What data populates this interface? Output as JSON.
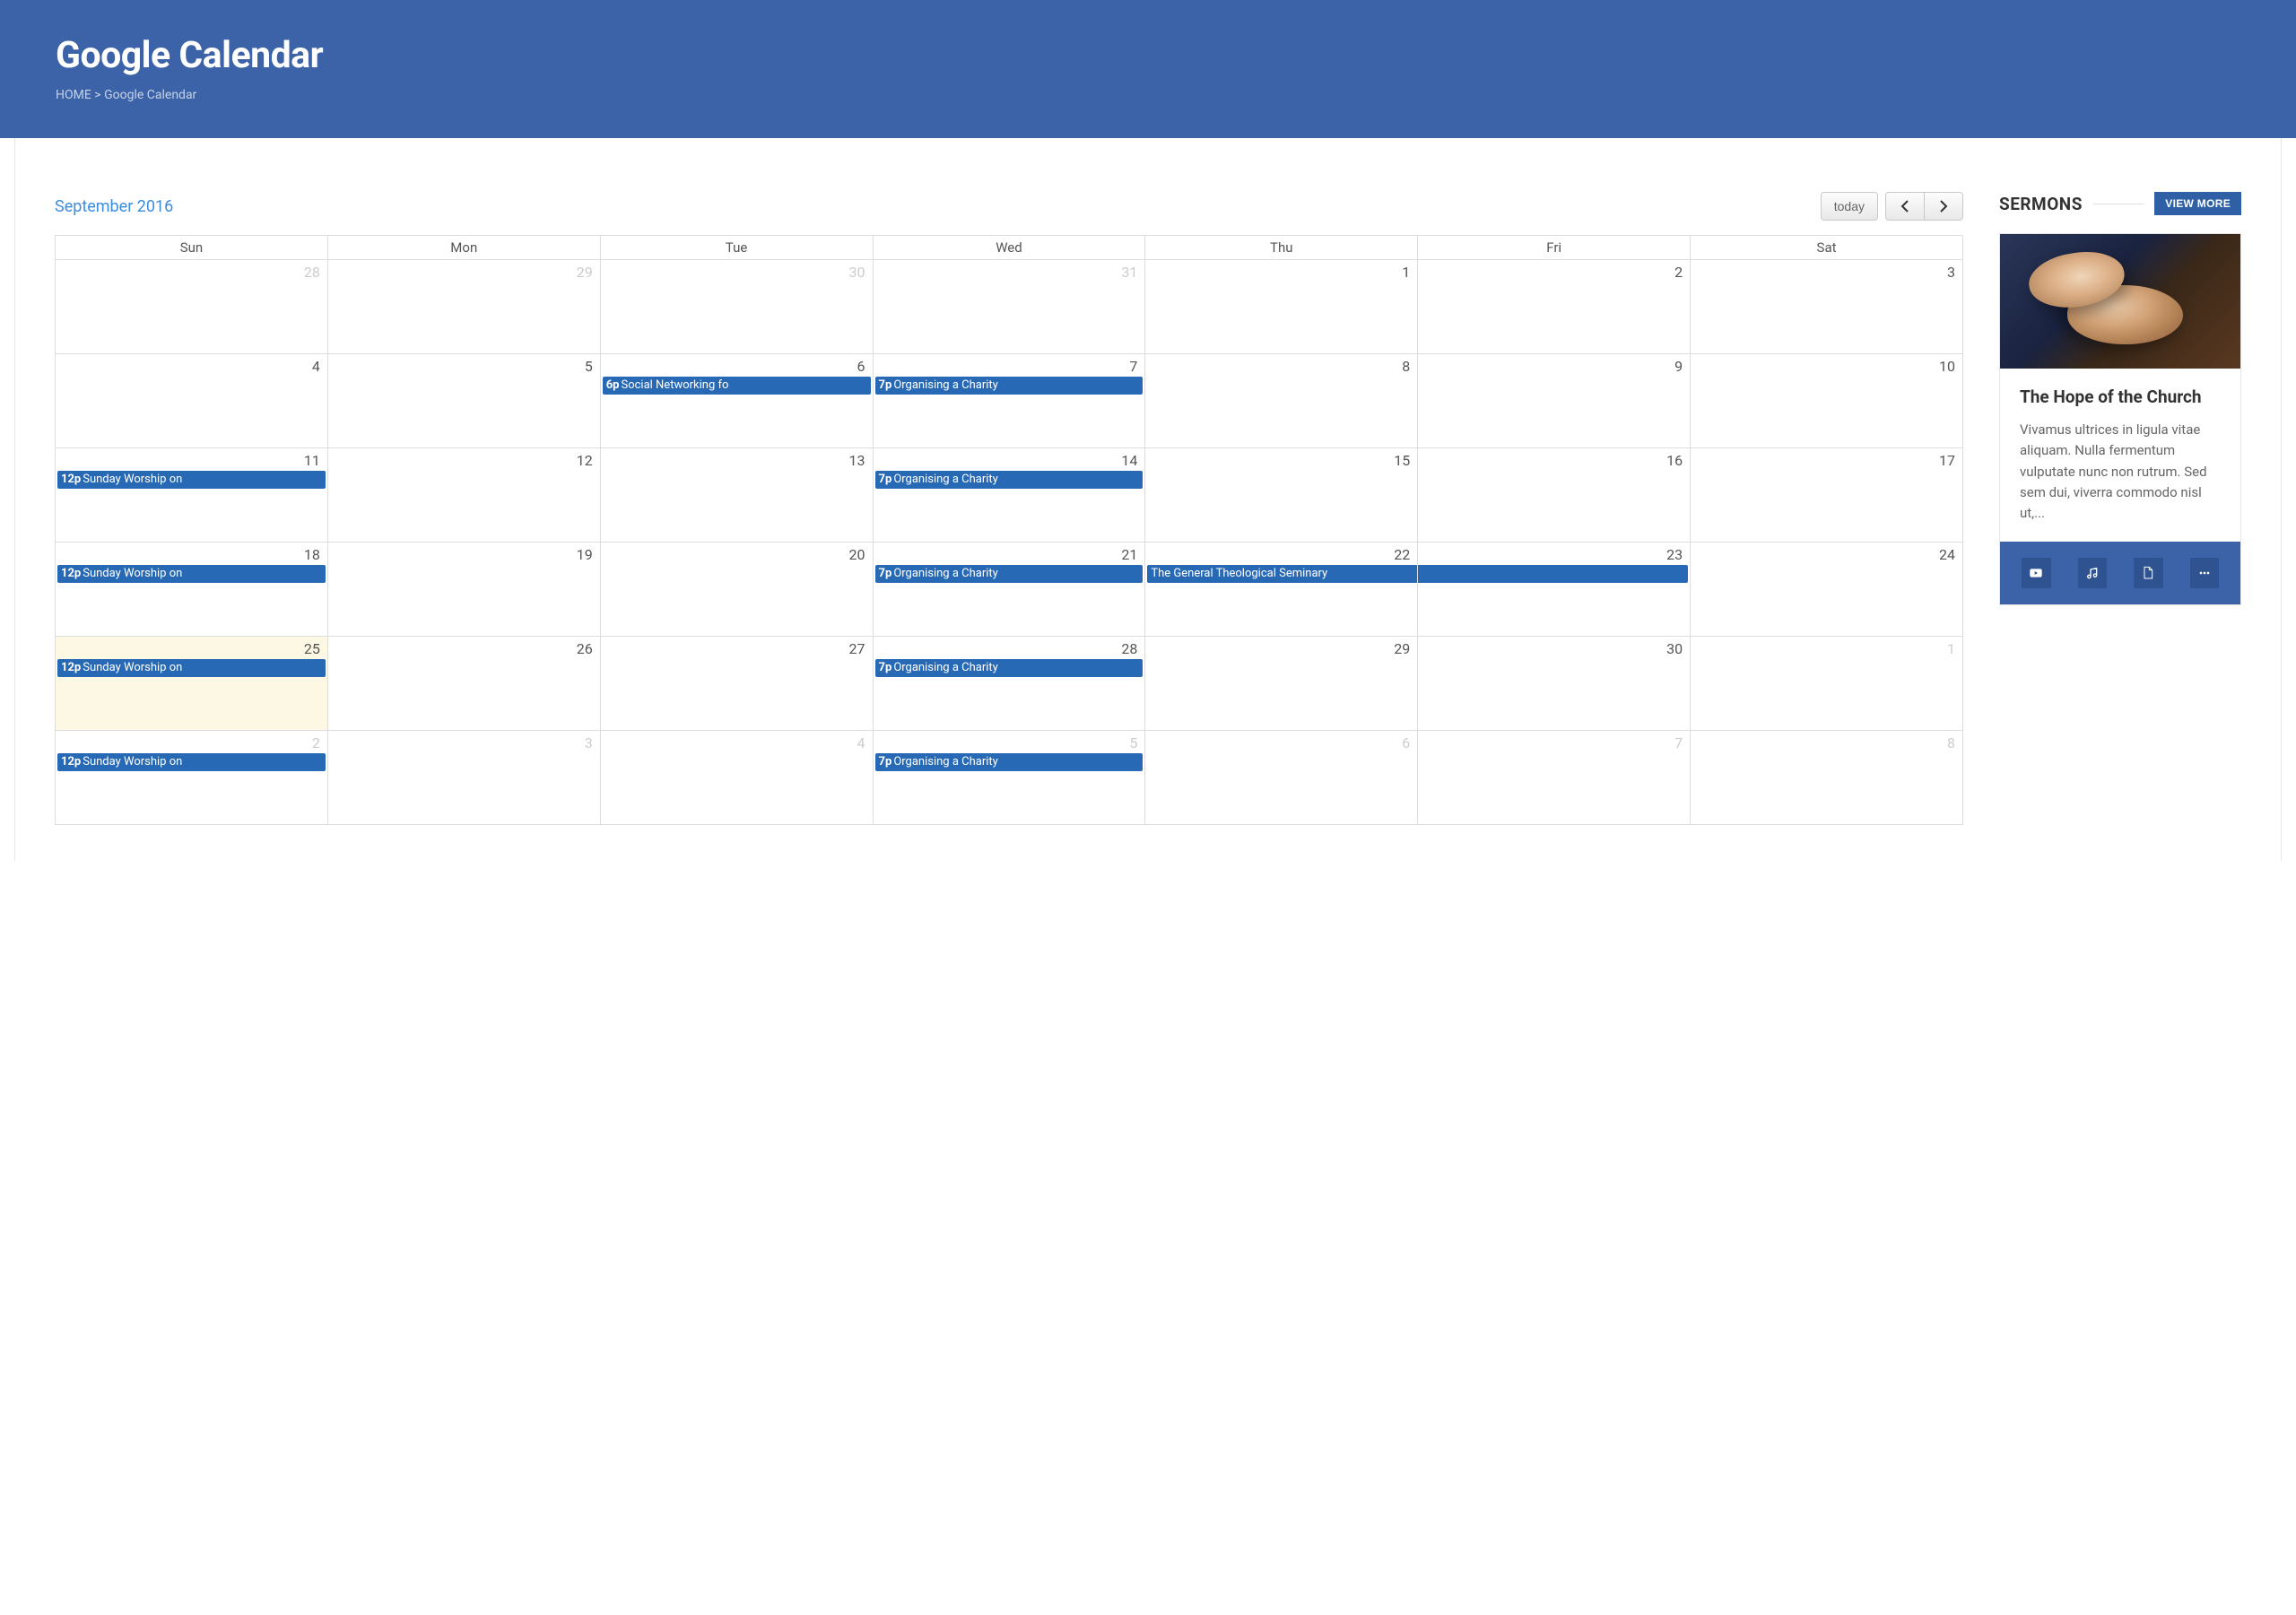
{
  "header": {
    "title": "Google Calendar",
    "breadcrumb_home": "HOME",
    "breadcrumb_sep": " > ",
    "breadcrumb_current": "Google Calendar"
  },
  "calendar": {
    "month_label": "September 2016",
    "today_label": "today",
    "day_headers": [
      "Sun",
      "Mon",
      "Tue",
      "Wed",
      "Thu",
      "Fri",
      "Sat"
    ],
    "weeks": [
      [
        {
          "num": "28",
          "other": true,
          "events": []
        },
        {
          "num": "29",
          "other": true,
          "events": []
        },
        {
          "num": "30",
          "other": true,
          "events": []
        },
        {
          "num": "31",
          "other": true,
          "events": []
        },
        {
          "num": "1",
          "events": []
        },
        {
          "num": "2",
          "events": []
        },
        {
          "num": "3",
          "events": []
        }
      ],
      [
        {
          "num": "4",
          "events": []
        },
        {
          "num": "5",
          "events": []
        },
        {
          "num": "6",
          "events": [
            {
              "time": "6p",
              "title": "Social Networking fo"
            }
          ]
        },
        {
          "num": "7",
          "events": [
            {
              "time": "7p",
              "title": "Organising a Charity"
            }
          ]
        },
        {
          "num": "8",
          "events": []
        },
        {
          "num": "9",
          "events": []
        },
        {
          "num": "10",
          "events": []
        }
      ],
      [
        {
          "num": "11",
          "events": [
            {
              "time": "12p",
              "title": "Sunday Worship on"
            }
          ]
        },
        {
          "num": "12",
          "events": []
        },
        {
          "num": "13",
          "events": []
        },
        {
          "num": "14",
          "events": [
            {
              "time": "7p",
              "title": "Organising a Charity"
            }
          ]
        },
        {
          "num": "15",
          "events": []
        },
        {
          "num": "16",
          "events": []
        },
        {
          "num": "17",
          "events": []
        }
      ],
      [
        {
          "num": "18",
          "events": [
            {
              "time": "12p",
              "title": "Sunday Worship on"
            }
          ]
        },
        {
          "num": "19",
          "events": []
        },
        {
          "num": "20",
          "events": []
        },
        {
          "num": "21",
          "events": [
            {
              "time": "7p",
              "title": "Organising a Charity"
            }
          ]
        },
        {
          "num": "22",
          "events": [
            {
              "time": "",
              "title": "The General Theological Seminary",
              "span": "start"
            }
          ]
        },
        {
          "num": "23",
          "events": [
            {
              "time": "",
              "title": "",
              "span": "cont"
            }
          ]
        },
        {
          "num": "24",
          "events": []
        }
      ],
      [
        {
          "num": "25",
          "today": true,
          "events": [
            {
              "time": "12p",
              "title": "Sunday Worship on"
            }
          ]
        },
        {
          "num": "26",
          "events": []
        },
        {
          "num": "27",
          "events": []
        },
        {
          "num": "28",
          "events": [
            {
              "time": "7p",
              "title": "Organising a Charity"
            }
          ]
        },
        {
          "num": "29",
          "events": []
        },
        {
          "num": "30",
          "events": []
        },
        {
          "num": "1",
          "other": true,
          "events": []
        }
      ],
      [
        {
          "num": "2",
          "other": true,
          "events": [
            {
              "time": "12p",
              "title": "Sunday Worship on"
            }
          ]
        },
        {
          "num": "3",
          "other": true,
          "events": []
        },
        {
          "num": "4",
          "other": true,
          "events": []
        },
        {
          "num": "5",
          "other": true,
          "events": [
            {
              "time": "7p",
              "title": "Organising a Charity"
            }
          ]
        },
        {
          "num": "6",
          "other": true,
          "events": []
        },
        {
          "num": "7",
          "other": true,
          "events": []
        },
        {
          "num": "8",
          "other": true,
          "events": []
        }
      ]
    ]
  },
  "sermons": {
    "heading": "SERMONS",
    "view_more": "VIEW MORE",
    "card": {
      "title": "The Hope of the Church",
      "excerpt": "Vivamus ultrices in ligula vitae aliquam. Nulla fermentum vulputate nunc non rutrum. Sed sem dui, viverra commodo nisl ut,..."
    },
    "actions": [
      "video",
      "audio",
      "pdf",
      "more"
    ]
  }
}
